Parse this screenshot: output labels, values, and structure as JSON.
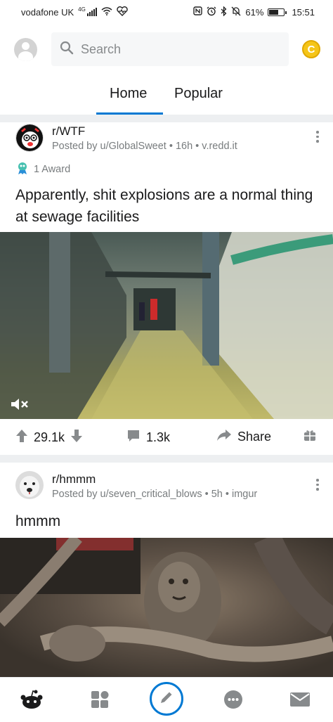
{
  "status_bar": {
    "carrier": "vodafone UK",
    "network": "4G",
    "battery_percent": "61%",
    "battery_level": 0.61,
    "time": "15:51"
  },
  "search": {
    "placeholder": "Search"
  },
  "tabs": [
    {
      "label": "Home",
      "active": true
    },
    {
      "label": "Popular",
      "active": false
    }
  ],
  "posts": [
    {
      "subreddit": "r/WTF",
      "meta": "Posted by u/GlobalSweet • 16h • v.redd.it",
      "award": "1 Award",
      "title": "Apparently, shit explosions are a normal thing at sewage facilities",
      "media": "video",
      "upvotes": "29.1k",
      "comments": "1.3k",
      "share_label": "Share"
    },
    {
      "subreddit": "r/hmmm",
      "meta": "Posted by u/seven_critical_blows • 5h • imgur",
      "title": "hmmm",
      "media": "image"
    }
  ],
  "bottom_nav": [
    "home-icon",
    "communities-icon",
    "create-post-icon",
    "chat-icon",
    "inbox-icon"
  ],
  "colors": {
    "accent": "#0079d3",
    "coin": "#f5c518",
    "meta_text": "#787c7e"
  }
}
